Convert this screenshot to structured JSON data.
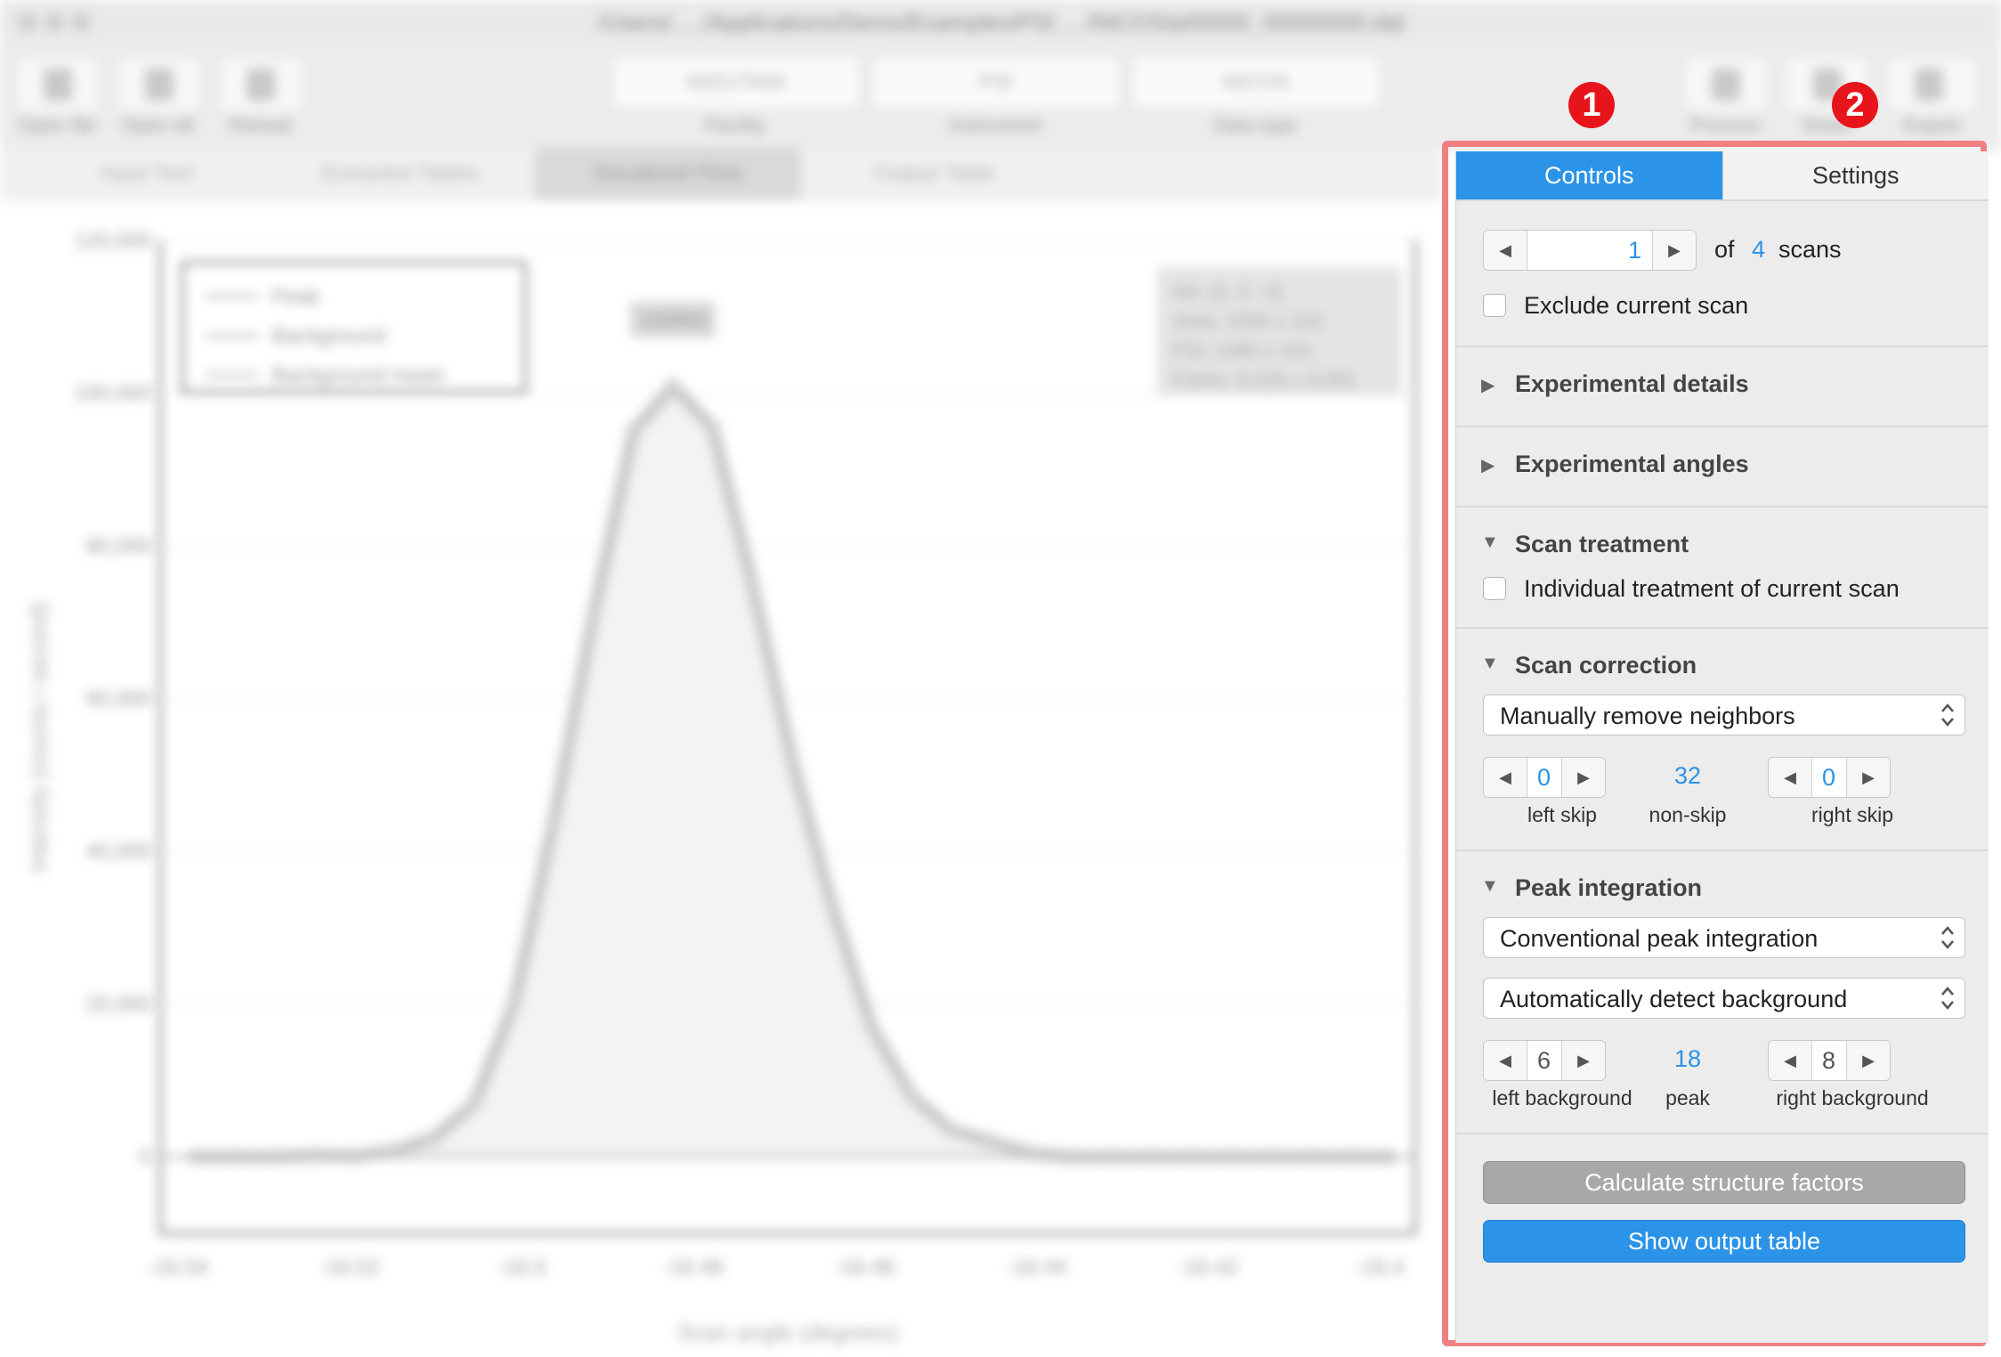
{
  "window": {
    "title": "/Users/...../Applications/Demo/Examples/PSI_.../NICOS/p00000_00000000.dat"
  },
  "toolbar": {
    "left_buttons": [
      {
        "label": "Open file",
        "icon": "file-icon"
      },
      {
        "label": "Open dir",
        "icon": "folder-icon"
      },
      {
        "label": "Reload",
        "icon": "reload-icon"
      }
    ],
    "fields": [
      {
        "value": "MIZUTANI",
        "label": "Facility"
      },
      {
        "value": "PSI",
        "label": "Instrument"
      },
      {
        "value": "NICOS",
        "label": "Data type"
      }
    ],
    "right_buttons": [
      {
        "label": "Process",
        "icon": "rocket-icon"
      },
      {
        "label": "Sheet",
        "icon": "sheet-icon"
      },
      {
        "label": "Export",
        "icon": "download-icon"
      }
    ]
  },
  "main_tabs": [
    "Input Text",
    "Extracted Tables",
    "Visualized Plots",
    "Output Table"
  ],
  "callouts": {
    "one": "1",
    "two": "2"
  },
  "panel": {
    "tabs": {
      "controls": "Controls",
      "settings": "Settings"
    },
    "scan": {
      "current": "1",
      "of_label": "of",
      "total": "4",
      "scans_label": "scans"
    },
    "exclude_label": "Exclude current scan",
    "sections": {
      "experimental_details": "Experimental details",
      "experimental_angles": "Experimental angles",
      "scan_treatment": "Scan treatment",
      "scan_correction": "Scan correction",
      "peak_integration": "Peak integration"
    },
    "individual_label": "Individual treatment of current scan",
    "correction": {
      "method": "Manually remove neighbors",
      "left_skip": "0",
      "non_skip": "32",
      "right_skip": "0",
      "left_skip_label": "left skip",
      "non_skip_label": "non-skip",
      "right_skip_label": "right skip"
    },
    "integration": {
      "method": "Conventional peak integration",
      "background": "Automatically detect background",
      "left_background": "6",
      "peak": "18",
      "right_background": "8",
      "left_background_label": "left background",
      "peak_label": "peak",
      "right_background_label": "right background"
    },
    "buttons": {
      "calculate": "Calculate structure factors",
      "show_output": "Show output table"
    }
  },
  "chart_data": {
    "type": "line",
    "title": "",
    "xlabel": "Scan angle (degrees)",
    "ylabel": "Intensity (counts / second)",
    "x_ticks": [
      "-16.54",
      "-16.52",
      "-16.5",
      "-16.48",
      "-16.46",
      "-16.44",
      "-16.42",
      "-16.4"
    ],
    "y_ticks": [
      "0",
      "20,000",
      "40,000",
      "60,000",
      "80,000",
      "100,000",
      "120,000"
    ],
    "ylim": [
      -10000,
      120000
    ],
    "legend": [
      "Peak",
      "Background",
      "Background mean"
    ],
    "legend_position": "top-left",
    "annotation_box": [
      "hkl: (2, 2, -4)",
      "Area: 1538 ± 122",
      "FSI: 1480 ± 101",
      "Fwhm: 0.026 ± 0.001"
    ],
    "peak_label": "100863",
    "series": [
      {
        "name": "Peak",
        "values": [
          0,
          0,
          0,
          200,
          100,
          800,
          2500,
          7000,
          20000,
          44000,
          71000,
          95000,
          100863,
          95500,
          75000,
          52000,
          33000,
          17000,
          8000,
          3500,
          2000,
          500,
          0,
          0,
          0,
          0,
          0,
          0,
          0,
          0,
          0
        ]
      }
    ],
    "color": "#c8c8c8"
  }
}
